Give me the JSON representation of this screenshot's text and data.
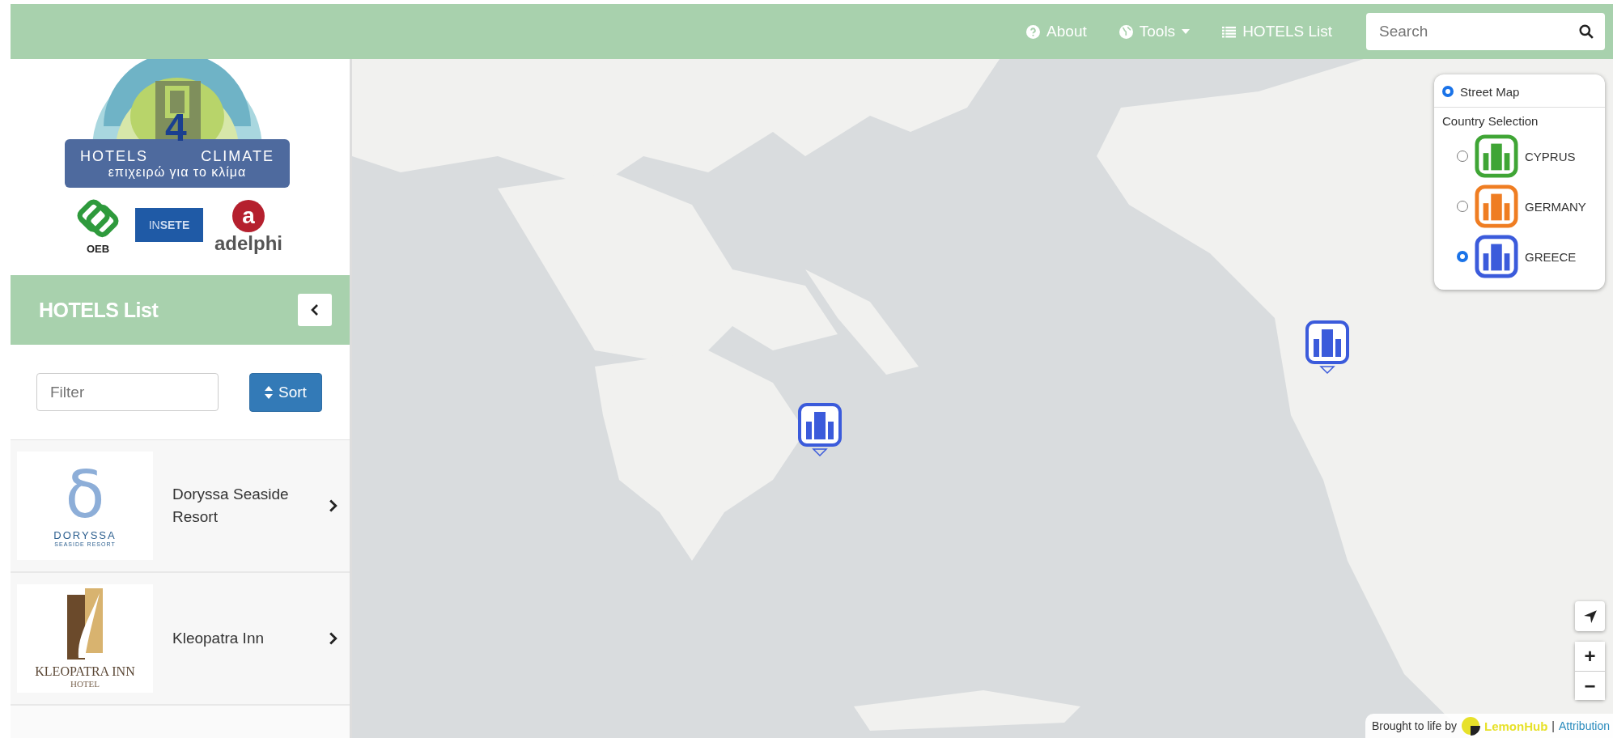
{
  "nav": {
    "links": [
      {
        "label": "About",
        "kind": "question",
        "dropdown": false
      },
      {
        "label": "Tools",
        "kind": "globe",
        "dropdown": true
      },
      {
        "label": "HOTELS List",
        "kind": "list",
        "dropdown": false
      }
    ],
    "search": {
      "placeholder": "Search"
    }
  },
  "logo": {
    "digit": "4",
    "left": "HOTELS",
    "right": "CLIMATE",
    "tagline": "επιχειρώ για το κλίμα"
  },
  "partners": [
    {
      "kind": "oeb",
      "label": "OEB"
    },
    {
      "kind": "insete",
      "label": "IN**SETE**"
    },
    {
      "kind": "adelphi",
      "mark": "a",
      "label": "adelphi"
    }
  ],
  "sidebar": {
    "title": "HOTELS List",
    "filter": {
      "placeholder": "Filter"
    },
    "sort_button": "Sort"
  },
  "hotels": [
    {
      "name": "Doryssa Seaside Resort",
      "logo": {
        "kind": "doryssa",
        "symbol": "δ",
        "lines": [
          "DORYSSA",
          "SEASIDE RESORT"
        ]
      }
    },
    {
      "name": "Kleopatra Inn",
      "logo": {
        "kind": "kleopatra",
        "lines": [
          "KLEOPATRA INN",
          "HOTEL"
        ]
      }
    }
  ],
  "markers": [
    {
      "kind": "hotel",
      "color": "#3b5bdb"
    },
    {
      "kind": "hotel",
      "color": "#3b5bdb"
    }
  ],
  "layers": {
    "base": [
      {
        "label": "Street Map",
        "selected": true
      }
    ],
    "title": "Country Selection",
    "countries": [
      {
        "label": "CYPRUS",
        "color": "#3fa535",
        "selected": false
      },
      {
        "label": "GERMANY",
        "color": "#ef7d22",
        "selected": false
      },
      {
        "label": "GREECE",
        "color": "#3b5bdb",
        "selected": true
      }
    ]
  },
  "zoom": {
    "in": "+",
    "out": "−"
  },
  "attribution": {
    "prefix": "Brought to life by",
    "brand": "Lemon**Hub**",
    "separator": "|",
    "link": "Attribution"
  }
}
